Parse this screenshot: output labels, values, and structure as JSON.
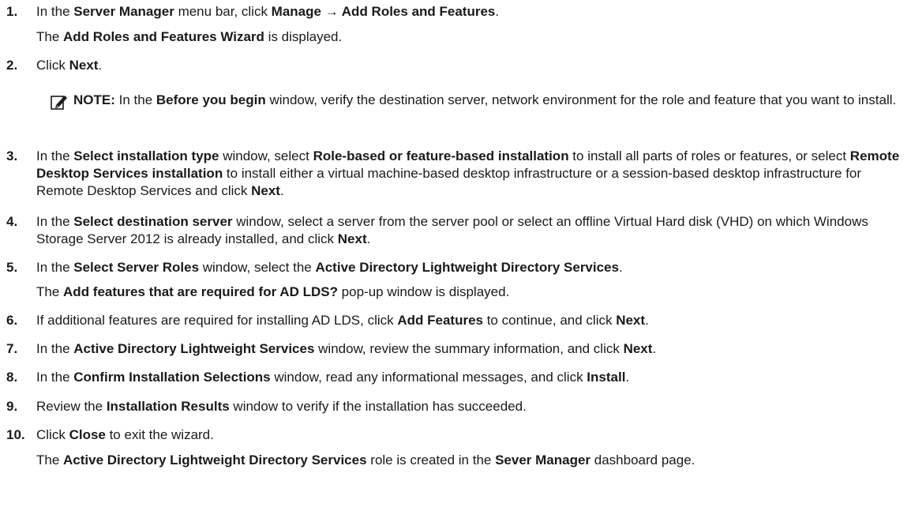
{
  "steps": [
    {
      "num": "1.",
      "parts": [
        {
          "t": "In the "
        },
        {
          "t": "Server Manager",
          "b": true
        },
        {
          "t": " menu bar, click "
        },
        {
          "t": "Manage → Add Roles and Features",
          "b": true
        },
        {
          "t": "."
        }
      ]
    },
    {
      "num": "",
      "parts": [
        {
          "t": "The "
        },
        {
          "t": "Add Roles and Features Wizard",
          "b": true
        },
        {
          "t": " is displayed."
        }
      ]
    },
    {
      "num": "2.",
      "parts": [
        {
          "t": "Click "
        },
        {
          "t": "Next",
          "b": true
        },
        {
          "t": "."
        }
      ]
    },
    {
      "num": "3.",
      "parts": [
        {
          "t": "In the "
        },
        {
          "t": "Select installation type",
          "b": true
        },
        {
          "t": " window, select "
        },
        {
          "t": "Role-based or feature-based installation",
          "b": true
        },
        {
          "t": " to install all parts of roles or features, or select "
        },
        {
          "t": "Remote Desktop Services installation",
          "b": true
        },
        {
          "t": " to install either a virtual machine-based desktop infrastructure or a session-based desktop infrastructure for Remote Desktop Services and click "
        },
        {
          "t": "Next",
          "b": true
        },
        {
          "t": "."
        }
      ]
    },
    {
      "num": "4.",
      "parts": [
        {
          "t": "In the "
        },
        {
          "t": "Select destination server",
          "b": true
        },
        {
          "t": " window, select a server from the server pool or select an offline Virtual Hard disk (VHD) on which Windows Storage Server 2012 is already installed, and click "
        },
        {
          "t": "Next",
          "b": true
        },
        {
          "t": "."
        }
      ]
    },
    {
      "num": "5.",
      "parts": [
        {
          "t": "In the "
        },
        {
          "t": "Select Server Roles",
          "b": true
        },
        {
          "t": " window, select the "
        },
        {
          "t": "Active Directory Lightweight Directory Services",
          "b": true
        },
        {
          "t": "."
        }
      ]
    },
    {
      "num": "",
      "parts": [
        {
          "t": "The "
        },
        {
          "t": "Add features that are required for AD LDS?",
          "b": true
        },
        {
          "t": " pop-up window is displayed."
        }
      ]
    },
    {
      "num": "6.",
      "parts": [
        {
          "t": "If additional features are required for installing AD LDS, click "
        },
        {
          "t": "Add Features",
          "b": true
        },
        {
          "t": " to continue, and click "
        },
        {
          "t": "Next",
          "b": true
        },
        {
          "t": "."
        }
      ]
    },
    {
      "num": "7.",
      "parts": [
        {
          "t": "In the "
        },
        {
          "t": "Active Directory Lightweight Services",
          "b": true
        },
        {
          "t": " window, review the summary information, and click "
        },
        {
          "t": "Next",
          "b": true
        },
        {
          "t": "."
        }
      ]
    },
    {
      "num": "8.",
      "parts": [
        {
          "t": "In the "
        },
        {
          "t": "Confirm Installation Selections",
          "b": true
        },
        {
          "t": " window, read any informational messages, and click "
        },
        {
          "t": "Install",
          "b": true
        },
        {
          "t": "."
        }
      ]
    },
    {
      "num": "9.",
      "parts": [
        {
          "t": "Review the "
        },
        {
          "t": "Installation Results",
          "b": true
        },
        {
          "t": " window to verify if the installation has succeeded."
        }
      ]
    },
    {
      "num": "10.",
      "parts": [
        {
          "t": "Click "
        },
        {
          "t": "Close",
          "b": true
        },
        {
          "t": " to exit the wizard."
        }
      ]
    },
    {
      "num": "",
      "parts": [
        {
          "t": "The "
        },
        {
          "t": "Active Directory Lightweight Directory Services",
          "b": true
        },
        {
          "t": " role is created in the "
        },
        {
          "t": "Sever Manager",
          "b": true
        },
        {
          "t": " dashboard page."
        }
      ]
    }
  ],
  "note": {
    "icon": "pencil-note-icon",
    "parts": [
      {
        "t": "NOTE:",
        "b": true
      },
      {
        "t": " In the "
      },
      {
        "t": "Before you begin",
        "b": true
      },
      {
        "t": " window, verify the destination server, network environment for the role and feature that you want to install."
      }
    ]
  }
}
